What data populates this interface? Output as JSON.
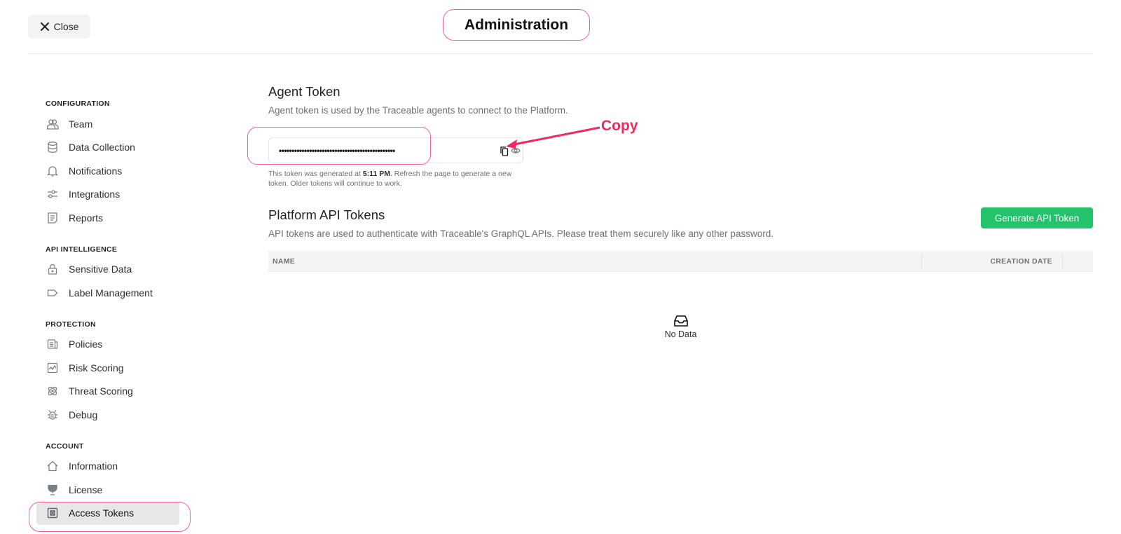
{
  "header": {
    "close_label": "Close",
    "title": "Administration"
  },
  "sidebar": {
    "sections": [
      {
        "label": "CONFIGURATION",
        "items": [
          {
            "label": "Team",
            "icon": "users-icon"
          },
          {
            "label": "Data Collection",
            "icon": "database-icon"
          },
          {
            "label": "Notifications",
            "icon": "bell-icon"
          },
          {
            "label": "Integrations",
            "icon": "sliders-icon"
          },
          {
            "label": "Reports",
            "icon": "report-icon"
          }
        ]
      },
      {
        "label": "API INTELLIGENCE",
        "items": [
          {
            "label": "Sensitive Data",
            "icon": "lock-icon"
          },
          {
            "label": "Label Management",
            "icon": "tag-icon"
          }
        ]
      },
      {
        "label": "PROTECTION",
        "items": [
          {
            "label": "Policies",
            "icon": "policy-icon"
          },
          {
            "label": "Risk Scoring",
            "icon": "pulse-chart-icon"
          },
          {
            "label": "Threat Scoring",
            "icon": "atom-icon"
          },
          {
            "label": "Debug",
            "icon": "bug-icon"
          }
        ]
      },
      {
        "label": "ACCOUNT",
        "items": [
          {
            "label": "Information",
            "icon": "home-icon"
          },
          {
            "label": "License",
            "icon": "trophy-icon"
          },
          {
            "label": "Access Tokens",
            "icon": "token-icon",
            "active": true
          }
        ]
      }
    ]
  },
  "agent_token": {
    "title": "Agent Token",
    "description": "Agent token is used by the Traceable agents to connect to the Platform.",
    "masked_value": "••••••••••••••••••••••••••••••••••••••••••••••",
    "note_prefix": "This token was generated at ",
    "note_time": "5:11 PM",
    "note_suffix": ". Refresh the page to generate a new token. Older tokens will continue to work."
  },
  "annotation": {
    "label": "Copy",
    "color": "#f2295f"
  },
  "api_tokens": {
    "title": "Platform API Tokens",
    "description": "API tokens are used to authenticate with Traceable's GraphQL APIs. Please treat them securely like any other password.",
    "generate_button": "Generate API Token",
    "columns": [
      "NAME",
      "CREATION DATE"
    ],
    "rows": [],
    "empty_text": "No Data"
  },
  "colors": {
    "accent_green": "#22c36b",
    "highlight_pink": "#f06292"
  }
}
